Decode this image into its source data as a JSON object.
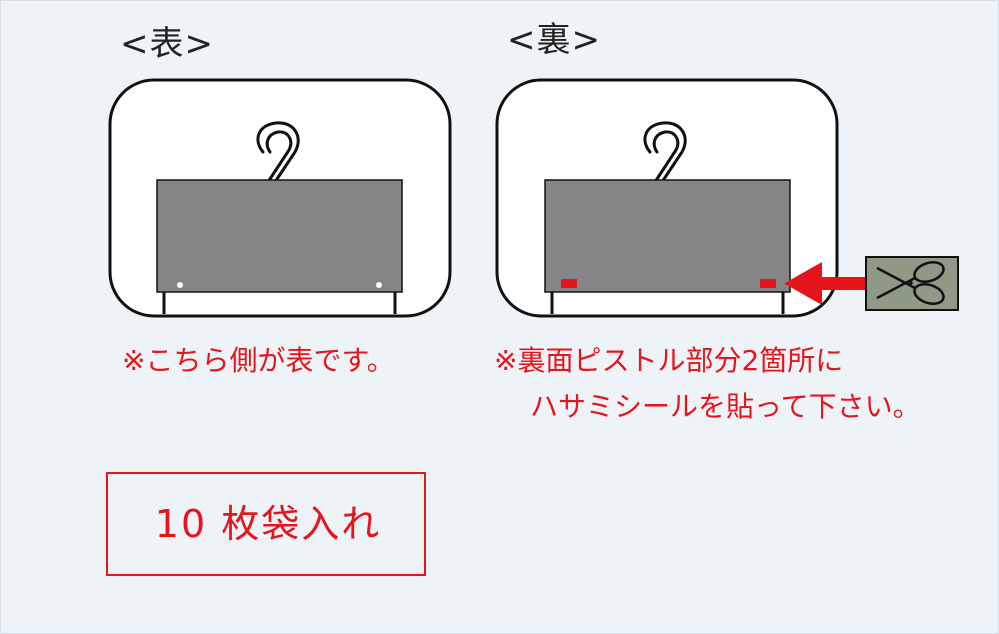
{
  "front": {
    "heading": "<表>",
    "note": "※こちら側が表です。"
  },
  "back": {
    "heading": "<裏>",
    "note_line1": "※裏面ピストル部分2箇所に",
    "note_line2": "ハサミシールを貼って下さい。"
  },
  "bag_count_label": "10 枚袋入れ",
  "colors": {
    "background": "#eef3f8",
    "accent_red": "#e5151b",
    "card_gray": "#858587",
    "sticker_fill": "#8e9a86"
  },
  "icons": [
    "hanger-icon",
    "scissors-icon",
    "arrow-left-icon"
  ]
}
